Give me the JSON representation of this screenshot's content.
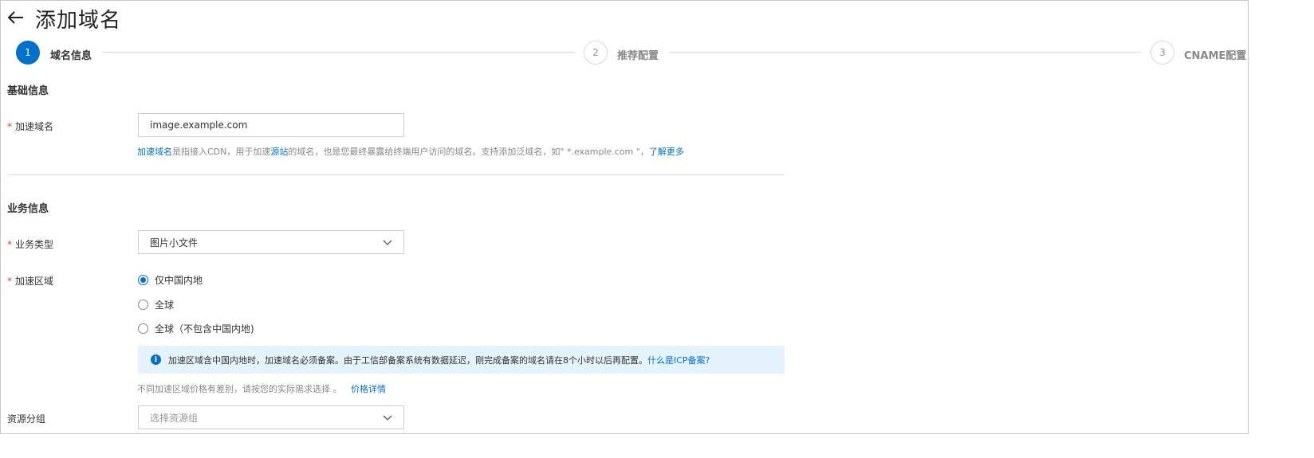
{
  "header": {
    "title": "添加域名"
  },
  "steps": [
    {
      "number": "1",
      "label": "域名信息"
    },
    {
      "number": "2",
      "label": "推荐配置"
    },
    {
      "number": "3",
      "label": "CNAME配置"
    }
  ],
  "basic": {
    "section_title": "基础信息",
    "domain_label": "加速域名",
    "domain_value": "image.example.com",
    "help": {
      "link1": "加速域名",
      "text1": "是指接入CDN，用于加速",
      "link2": "源站",
      "text2": "的域名，也是您最终暴露给终端用户访问的域名。支持添加泛域名，如\" *.example.com \"，",
      "link3": "了解更多"
    }
  },
  "business": {
    "section_title": "业务信息",
    "type_label": "业务类型",
    "type_value": "图片小文件",
    "region_label": "加速区域",
    "region_options": [
      {
        "label": "仅中国内地",
        "checked": true
      },
      {
        "label": "全球",
        "checked": false
      },
      {
        "label": "全球（不包含中国内地)",
        "checked": false
      }
    ],
    "notice_text": "加速区域含中国内地时，加速域名必须备案。由于工信部备案系统有数据延迟，刚完成备案的域名请在8个小时以后再配置。",
    "notice_link": "什么是ICP备案?",
    "price_text": "不同加速区域价格有差别，请按您的实际需求选择 。",
    "price_link": "价格详情",
    "group_label": "资源分组",
    "group_placeholder": "选择资源组"
  },
  "required_mark": "*",
  "colors": {
    "primary": "#0070cc",
    "required": "#e4393c",
    "notice_bg": "#e5f3fd"
  }
}
